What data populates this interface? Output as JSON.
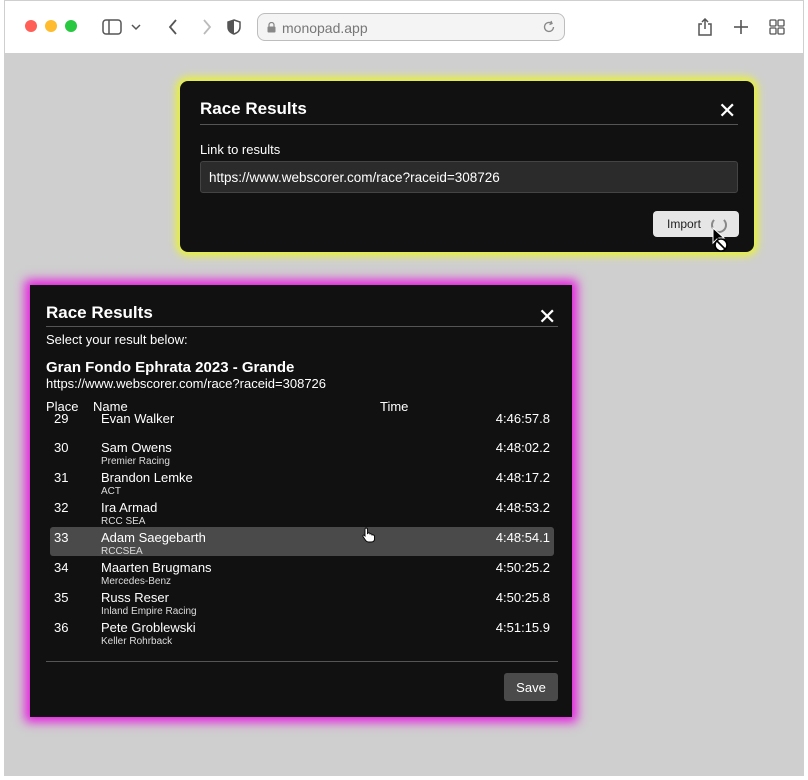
{
  "browser": {
    "url": "monopad.app",
    "traffic_colors": [
      "#ff5f57",
      "#febc2e",
      "#28c840"
    ]
  },
  "import_modal": {
    "title": "Race Results",
    "close_glyph": "✕",
    "link_label": "Link to results",
    "link_value": "https://www.webscorer.com/race?raceid=308726",
    "import_label": "Import"
  },
  "results_modal": {
    "title": "Race Results",
    "close_glyph": "✕",
    "instruction": "Select your result below:",
    "event_name": "Gran Fondo Ephrata 2023 - Grande",
    "event_url": "https://www.webscorer.com/race?raceid=308726",
    "columns": {
      "place": "Place",
      "name": "Name",
      "time": "Time"
    },
    "rows": [
      {
        "place": "29",
        "name": "Evan Walker",
        "team": "",
        "time": "4:46:57.8"
      },
      {
        "place": "30",
        "name": "Sam Owens",
        "team": "Premier Racing",
        "time": "4:48:02.2"
      },
      {
        "place": "31",
        "name": "Brandon Lemke",
        "team": "ACT",
        "time": "4:48:17.2"
      },
      {
        "place": "32",
        "name": "Ira Armad",
        "team": "RCC SEA",
        "time": "4:48:53.2"
      },
      {
        "place": "33",
        "name": "Adam Saegebarth",
        "team": "RCCSEA",
        "time": "4:48:54.1"
      },
      {
        "place": "34",
        "name": "Maarten Brugmans",
        "team": "Mercedes-Benz",
        "time": "4:50:25.2"
      },
      {
        "place": "35",
        "name": "Russ Reser",
        "team": "Inland Empire Racing",
        "time": "4:50:25.8"
      },
      {
        "place": "36",
        "name": "Pete Groblewski",
        "team": "Keller Rohrback",
        "time": "4:51:15.9"
      }
    ],
    "save_label": "Save"
  },
  "colors": {
    "top_glow": "#e8f23a",
    "bottom_glow": "#e51ddf",
    "selected_row": "#4a4a4a"
  }
}
